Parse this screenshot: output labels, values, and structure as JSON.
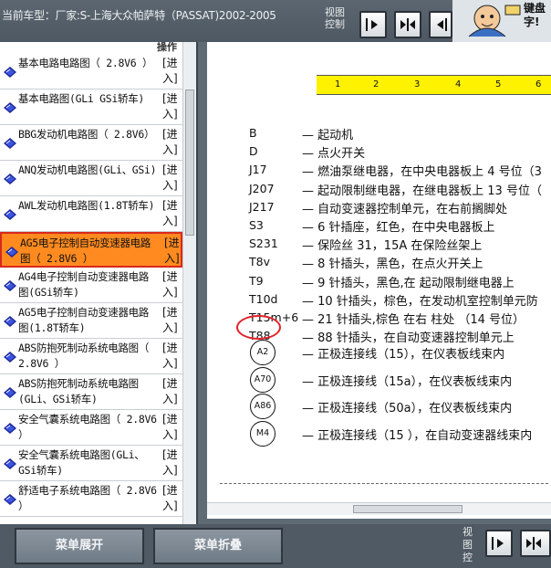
{
  "header": {
    "title": "当前车型：厂家:S-上海大众帕萨特（PASSAT)2002-2005",
    "view_control_label": "视图控制",
    "banner_text": "键盘字!"
  },
  "sidebar": {
    "column_header": "操作",
    "items": [
      {
        "label": "基本电路电路图（ 2.8V6 ）",
        "action": "[进入]"
      },
      {
        "label": "基本电路图(GLi GSi轿车)",
        "action": "[进入]"
      },
      {
        "label": "BBG发动机电路图（ 2.8V6）",
        "action": "[进入]"
      },
      {
        "label": "ANQ发动机电路图(GLi、GSi)",
        "action": "[进入]"
      },
      {
        "label": "AWL发动机电路图(1.8T轿车)",
        "action": "[进入]"
      },
      {
        "label": "AG5电子控制自动变速器电路图（ 2.8V6 ）",
        "action": "[进入]",
        "selected": true
      },
      {
        "label": "AG4电子控制自动变速器电路图(GSi轿车)",
        "action": "[进入]"
      },
      {
        "label": "AG5电子控制自动变速器电路图(1.8T轿车)",
        "action": "[进入]"
      },
      {
        "label": "ABS防抱死制动系统电路图（ 2.8V6 ）",
        "action": "[进入]"
      },
      {
        "label": "ABS防抱死制动系统电路图(GLi、GSi轿车)",
        "action": "[进入]"
      },
      {
        "label": "安全气囊系统电路图（ 2.8V6 ）",
        "action": "[进入]"
      },
      {
        "label": "安全气囊系统电路图(GLi、GSi轿车)",
        "action": "[进入]"
      },
      {
        "label": "舒适电子系统电路图（ 2.8V6 ）",
        "action": "[进入]"
      }
    ]
  },
  "diagram": {
    "ruler_numbers": [
      "1",
      "2",
      "3",
      "4",
      "5",
      "6"
    ],
    "legend": [
      {
        "code": "B",
        "desc": "— 起动机"
      },
      {
        "code": "D",
        "desc": "— 点火开关"
      },
      {
        "code": "J17",
        "desc": "— 燃油泵继电器，在中央电器板上 4 号位（3"
      },
      {
        "code": "J207",
        "desc": "— 起动限制继电器，在继电器板上 13 号位（"
      },
      {
        "code": "J217",
        "desc": "— 自动变速器控制单元，在右前搁脚处"
      },
      {
        "code": "S3",
        "desc": "— 6 针插座，红色，在中央电器板上"
      },
      {
        "code": "S231",
        "desc": "— 保险丝 31，15A 在保险丝架上"
      },
      {
        "code": "T8v",
        "desc": "— 8 针插头，黑色，在点火开关上"
      },
      {
        "code": "T9",
        "desc": "— 9 针插头，黑色,在   起动限制继电器上"
      },
      {
        "code": "T10d",
        "desc": "— 10 针插头，棕色，在发动机室控制单元防"
      },
      {
        "code": "T15m+6",
        "desc": "— 21 针插头,棕色 在右 柱处        （14 号位）"
      },
      {
        "code": "T88",
        "desc": "— 88 针插头，在自动变速器控制单元上"
      }
    ],
    "connectors": [
      {
        "code": "A2",
        "desc": "— 正极连接线（15），在仪表板线束内"
      },
      {
        "code": "A70",
        "desc": "— 正极连接线（15a），在仪表板线束内"
      },
      {
        "code": "A86",
        "desc": "— 正极连接线（50a），在仪表板线束内"
      },
      {
        "code": "M4",
        "desc": "— 正极连接线（15 ），在自动变速器线束内"
      }
    ]
  },
  "footer": {
    "expand_label": "菜单展开",
    "collapse_label": "菜单折叠",
    "view_control_label": "视图控"
  }
}
